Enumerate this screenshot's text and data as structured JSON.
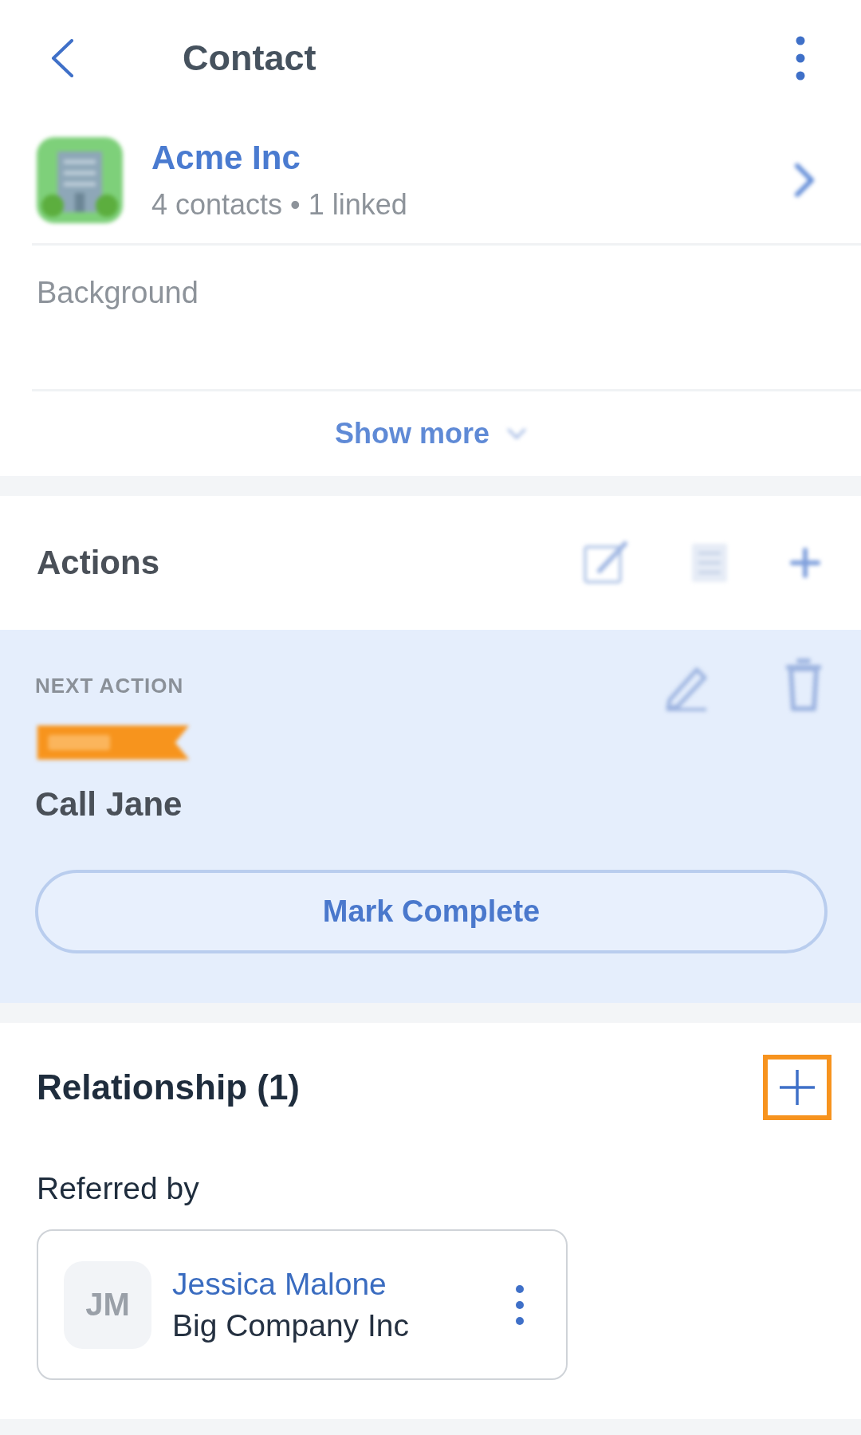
{
  "header": {
    "title": "Contact"
  },
  "company_card": {
    "blurred": true,
    "name": "Acme Inc",
    "subtitle": "4 contacts • 1 linked",
    "background_label": "Background",
    "show_more": "Show more"
  },
  "actions": {
    "blurred": true,
    "title": "Actions",
    "next_action": {
      "label": "NEXT ACTION",
      "title": "Call Jane",
      "button": "Mark Complete"
    }
  },
  "relationship": {
    "title": "Relationship (1)",
    "add_highlighted": true,
    "groups": [
      {
        "label": "Referred by",
        "contacts": [
          {
            "initials": "JM",
            "name": "Jessica Malone",
            "company": "Big Company Inc"
          }
        ]
      }
    ]
  }
}
